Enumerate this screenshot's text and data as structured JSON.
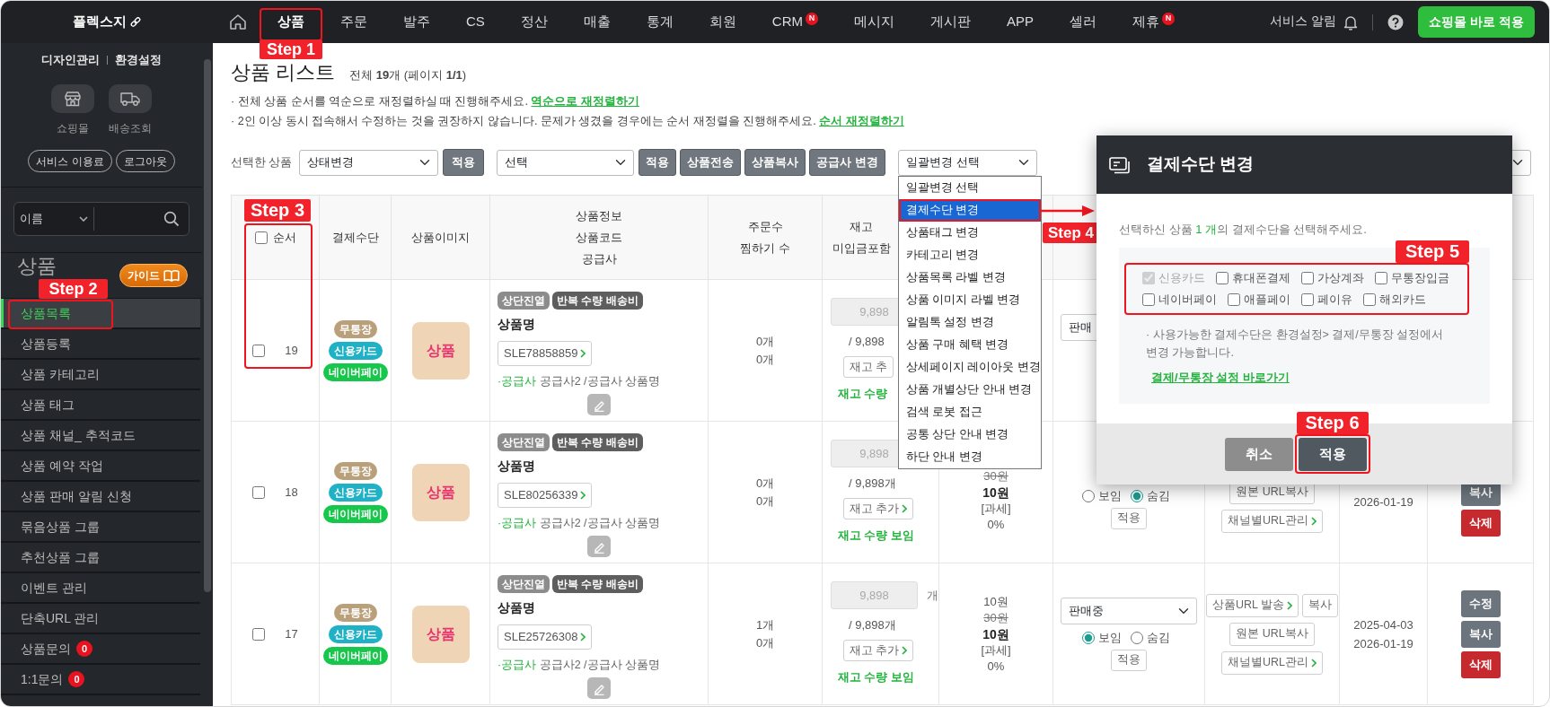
{
  "topbar": {
    "logo": "플렉스지",
    "nav": [
      {
        "label": "상품",
        "selected": true,
        "step": "Step 1"
      },
      {
        "label": "주문",
        "selected": false
      },
      {
        "label": "발주",
        "selected": false
      },
      {
        "label": "CS",
        "selected": false
      },
      {
        "label": "정산",
        "selected": false
      },
      {
        "label": "매출",
        "selected": false
      },
      {
        "label": "통계",
        "selected": false
      },
      {
        "label": "회원",
        "selected": false
      },
      {
        "label": "CRM",
        "selected": false,
        "badge": "N"
      },
      {
        "label": "메시지",
        "selected": false
      },
      {
        "label": "게시판",
        "selected": false
      },
      {
        "label": "APP",
        "selected": false
      },
      {
        "label": "셀러",
        "selected": false
      },
      {
        "label": "제휴",
        "selected": false,
        "badge": "N"
      }
    ],
    "alert_label": "서비스 알림",
    "apply_button": "쇼핑몰 바로 적용"
  },
  "sidebar": {
    "links": [
      "디자인관리",
      "환경설정"
    ],
    "shortcuts": [
      {
        "label": "쇼핑몰",
        "kind": "store"
      },
      {
        "label": "배송조회",
        "kind": "truck"
      }
    ],
    "buttons": [
      "서비스 이용료",
      "로그아웃"
    ],
    "search": {
      "field": "이름"
    },
    "section": {
      "title": "상품",
      "guide": "가이드"
    },
    "items": [
      {
        "label": "상품목록",
        "selected": true,
        "step": "Step 2"
      },
      {
        "label": "상품등록",
        "selected": false
      },
      {
        "label": "상품 카테고리",
        "selected": false
      },
      {
        "label": "상품 태그",
        "selected": false
      },
      {
        "label": "상품 채널_ 추적코드",
        "selected": false
      },
      {
        "label": "상품 예약 작업",
        "selected": false
      },
      {
        "label": "상품 판매 알림 신청",
        "selected": false
      },
      {
        "label": "묶음상품 그룹",
        "selected": false
      },
      {
        "label": "추천상품 그룹",
        "selected": false
      },
      {
        "label": "이벤트 관리",
        "selected": false
      },
      {
        "label": "단축URL 관리",
        "selected": false
      },
      {
        "label": "상품문의",
        "selected": false,
        "badge": "0"
      },
      {
        "label": "1:1문의",
        "selected": false,
        "badge": "0"
      }
    ]
  },
  "page": {
    "title": "상품 리스트",
    "summary": "전체 **19**개 (페이지 **1/1**)",
    "notes": [
      {
        "text": "· 전체 상품 순서를 역순으로 재정렬하실 때 진행해주세요.",
        "link": "역순으로 재정렬하기"
      },
      {
        "text": "· 2인 이상 동시 접속해서 수정하는 것을 권장하지 않습니다. 문제가 생겼을 경우에는 순서 재정렬을 진행해주세요.",
        "link": "순서 재정렬하기"
      }
    ]
  },
  "toolbar": {
    "label": "선택한 상품",
    "status_select": "상태변경",
    "apply": "적용",
    "action_select": "선택",
    "buttons": [
      "적용",
      "상품전송",
      "상품복사",
      "공급사 변경"
    ],
    "bulk_select": "일괄변경 선택"
  },
  "bulk_menu": {
    "items": [
      {
        "label": "일괄변경 선택",
        "selected": false
      },
      {
        "label": "결제수단 변경",
        "selected": true,
        "step": "Step 4"
      },
      {
        "label": "상품태그 변경",
        "selected": false
      },
      {
        "label": "카테고리 변경",
        "selected": false
      },
      {
        "label": "상품목록 라벨 변경",
        "selected": false
      },
      {
        "label": "상품 이미지 라벨 변경",
        "selected": false
      },
      {
        "label": "알림톡 설정 변경",
        "selected": false
      },
      {
        "label": "상품 구매 혜택 변경",
        "selected": false
      },
      {
        "label": "상세페이지 레이아웃 변경",
        "selected": false
      },
      {
        "label": "상품 개별상단 안내 변경",
        "selected": false
      },
      {
        "label": "검색 로봇 접근",
        "selected": false
      },
      {
        "label": "공통 상단 안내 변경",
        "selected": false
      },
      {
        "label": "하단 안내 변경",
        "selected": false
      }
    ]
  },
  "table": {
    "columns": [
      {
        "lines": [
          "순서"
        ],
        "checked": false,
        "step": "Step 3"
      },
      {
        "lines": [
          "결제수단"
        ]
      },
      {
        "lines": [
          "상품이미지"
        ]
      },
      {
        "lines": [
          "상품정보",
          "상품코드",
          "공급사"
        ]
      },
      {
        "lines": [
          "주문수",
          "찜하기 수"
        ]
      },
      {
        "lines": [
          "재고",
          "미입금포함"
        ]
      }
    ],
    "rows": [
      {
        "checked": false,
        "order": "19",
        "payments": [
          {
            "label": "무통장",
            "color": "#b9a07a"
          },
          {
            "label": "신용카드",
            "color": "#1fb1c6"
          },
          {
            "label": "네이버페이",
            "color": "#17c74b"
          }
        ],
        "image": "상품",
        "tags": [
          {
            "label": "상단진열",
            "color": "#8c8c8c"
          },
          {
            "label": "반복 수량 배송비",
            "color": "#5e5e5e"
          }
        ],
        "name": "상품명",
        "code": "SLE78858859",
        "supplier": "**·공급사** 공급사2 /공급사 상품명",
        "orders": [
          "0개",
          "0개"
        ],
        "stock": {
          "value": "9,898",
          "total": "/ 9,898",
          "add": {
            "label": "재고 추",
            "arrow": false
          },
          "visibility": "재고 수량"
        },
        "status": {
          "select": "판매"
        }
      },
      {
        "checked": false,
        "order": "18",
        "payments": [
          {
            "label": "무통장",
            "color": "#b9a07a"
          },
          {
            "label": "신용카드",
            "color": "#1fb1c6"
          },
          {
            "label": "네이버페이",
            "color": "#17c74b"
          }
        ],
        "image": "상품",
        "tags": [
          {
            "label": "상단진열",
            "color": "#8c8c8c"
          },
          {
            "label": "반복 수량 배송비",
            "color": "#5e5e5e"
          }
        ],
        "name": "상품명",
        "code": "SLE80256339",
        "supplier": "**·공급사** 공급사2 /공급사 상품명",
        "orders": [
          "0개",
          "0개"
        ],
        "stock": {
          "value": "9,898",
          "total": "/ 9,898개",
          "add": {
            "label": "재고 추가",
            "arrow": true
          },
          "visibility": "재고 수량 보임"
        },
        "price": [
          {
            "text": "30원",
            "kind": "strike"
          },
          {
            "text": "10원",
            "kind": "bold"
          },
          {
            "text": "[과세]",
            "kind": "plain"
          },
          {
            "text": "0%",
            "kind": "plain"
          }
        ],
        "status": {
          "visibility": [
            {
              "label": "보임",
              "selected": false
            },
            {
              "label": "숨김",
              "selected": true
            }
          ],
          "apply": "적용"
        },
        "urls": [
          [
            {
              "label": "원본 URL복사",
              "arrow": false
            }
          ],
          [
            {
              "label": "채널별URL관리",
              "arrow": true
            }
          ]
        ],
        "dates": [
          "2026-01-19"
        ],
        "actions": [
          {
            "label": "복사",
            "kind": "copy"
          },
          {
            "label": "삭제",
            "kind": "delete"
          }
        ]
      },
      {
        "checked": false,
        "order": "17",
        "payments": [
          {
            "label": "무통장",
            "color": "#b9a07a"
          },
          {
            "label": "신용카드",
            "color": "#1fb1c6"
          },
          {
            "label": "네이버페이",
            "color": "#17c74b"
          }
        ],
        "image": "상품",
        "tags": [
          {
            "label": "상단진열",
            "color": "#8c8c8c"
          },
          {
            "label": "반복 수량 배송비",
            "color": "#5e5e5e"
          }
        ],
        "name": "상품명",
        "code": "SLE25726308",
        "supplier": "**·공급사** 공급사2 /공급사 상품명",
        "orders": [
          "1개",
          "0개"
        ],
        "stock": {
          "value": "9,898",
          "unit": "개",
          "total": "/ 9,898개",
          "add": {
            "label": "재고 추가",
            "arrow": true
          },
          "visibility": "재고 수량 보임"
        },
        "price": [
          {
            "text": "10원",
            "kind": "plain"
          },
          {
            "text": "30원",
            "kind": "strike"
          },
          {
            "text": "10원",
            "kind": "bold"
          },
          {
            "text": "[과세]",
            "kind": "plain"
          },
          {
            "text": "0%",
            "kind": "plain"
          }
        ],
        "status": {
          "select": "판매중",
          "visibility": [
            {
              "label": "보임",
              "selected": true
            },
            {
              "label": "숨김",
              "selected": false
            }
          ],
          "apply": "적용"
        },
        "urls": [
          [
            {
              "label": "상품URL 발송",
              "arrow": true
            },
            {
              "label": "복사",
              "arrow": false
            }
          ],
          [
            {
              "label": "원본 URL복사",
              "arrow": false
            }
          ],
          [
            {
              "label": "채널별URL관리",
              "arrow": true
            }
          ]
        ],
        "dates": [
          "2025-04-03",
          "2026-01-19"
        ],
        "actions": [
          {
            "label": "수정",
            "kind": "edit"
          },
          {
            "label": "복사",
            "kind": "copy"
          },
          {
            "label": "삭제",
            "kind": "delete"
          }
        ]
      }
    ]
  },
  "dialog": {
    "title": "결제수단 변경",
    "message": "선택하신 상품 **1 개**의 결제수단을 선택해주세요.",
    "options": [
      {
        "label": "신용카드",
        "checked": true,
        "disabled": true
      },
      {
        "label": "휴대폰결제",
        "checked": false,
        "disabled": false
      },
      {
        "label": "가상계좌",
        "checked": false,
        "disabled": false
      },
      {
        "label": "무통장입금",
        "checked": false,
        "disabled": false
      },
      {
        "label": "네이버페이",
        "checked": false,
        "disabled": false
      },
      {
        "label": "애플페이",
        "checked": false,
        "disabled": false
      },
      {
        "label": "페이유",
        "checked": false,
        "disabled": false
      },
      {
        "label": "해외카드",
        "checked": false,
        "disabled": false
      }
    ],
    "options_step": "Step 5",
    "note": "· 사용가능한 결제수단은 환경설정> 결제/무통장 설정에서 변경 가능합니다.",
    "link": "결제/무통장 설정 바로가기",
    "buttons": [
      {
        "label": "취소",
        "kind": "cancel"
      },
      {
        "label": "적용",
        "kind": "apply",
        "step": "Step 6"
      }
    ]
  }
}
